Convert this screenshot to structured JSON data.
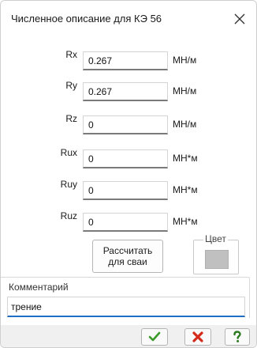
{
  "dialog": {
    "title": "Численное описание для КЭ 56",
    "close_icon": "close-icon"
  },
  "fields": [
    {
      "label": "Rx",
      "value": "0.267",
      "unit": "МН/м"
    },
    {
      "label": "Ry",
      "value": "0.267",
      "unit": "МН/м"
    },
    {
      "label": "Rz",
      "value": "0",
      "unit": "МН/м"
    },
    {
      "label": "Rux",
      "value": "0",
      "unit": "МН*м"
    },
    {
      "label": "Ruy",
      "value": "0",
      "unit": "МН*м"
    },
    {
      "label": "Ruz",
      "value": "0",
      "unit": "МН*м"
    }
  ],
  "calc_button": {
    "line1": "Рассчитать",
    "line2": "для сваи"
  },
  "color_group": {
    "label": "Цвет",
    "swatch_color": "#c0c0c0"
  },
  "comment": {
    "label": "Комментарий",
    "value": "трение"
  },
  "actions": {
    "ok_icon": "check-icon",
    "ok_color": "#3a9a2a",
    "cancel_icon": "x-icon",
    "cancel_color": "#d42a1c",
    "help_icon": "question-icon",
    "help_color": "#2b7a1f"
  }
}
